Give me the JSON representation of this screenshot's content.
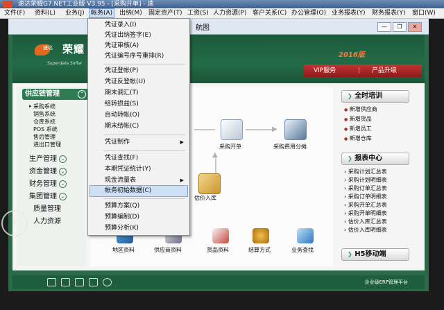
{
  "app": {
    "title": "速达荣耀G7.NET工业版 V3.95 - [采购开单] - 速"
  },
  "menubar": {
    "items": [
      "文件(F)",
      "资料(L)",
      "业务(J)",
      "帐务(A)",
      "出纳(M)",
      "固定资产(T)",
      "工资(S)",
      "人力资源(P)",
      "客户关系(C)",
      "办公管理(O)",
      "业务报表(Y)",
      "财务报表(Y)",
      "窗口(W)"
    ]
  },
  "inner_window": {
    "title": "航图"
  },
  "header": {
    "brand_name": "荣耀",
    "brand_prefix": "速达",
    "brand_sub": "Superdata Softw",
    "edition": "2016版",
    "vip": "VIP服务",
    "upgrade": "产品升级"
  },
  "left_panel": {
    "head": "供应链管理",
    "sub_items": [
      "采购系统",
      "销售系统",
      "仓库系统",
      "POS 系统",
      "售后管理",
      "进出口管理"
    ],
    "modules": [
      "生产管理",
      "资金管理",
      "财务管理",
      "集团管理",
      "质量管理",
      "人力资源"
    ]
  },
  "center": {
    "flow": {
      "purchase_order": "采购开单",
      "purchase_alloc": "采购费用分摊",
      "est_in": "估价入库"
    },
    "quick": [
      "地区资料",
      "供应商资料",
      "货品资料",
      "结算方式",
      "业务查找"
    ]
  },
  "right_panel": {
    "training": "全时培训",
    "training_links": [
      "新增供应商",
      "新增货品",
      "新增员工",
      "新增仓库"
    ],
    "report_head": "报表中心",
    "report_links": [
      "采购计划汇总表",
      "采购计划明细表",
      "采购订单汇总表",
      "采购订单明细表",
      "采购开单汇总表",
      "采购开单明细表",
      "估价入库汇总表",
      "估价入库明细表"
    ],
    "h5": "H5移动端"
  },
  "footer": {
    "text": "企业级ERP管理平台"
  },
  "dropdown": {
    "items": [
      "凭证录入(I)",
      "凭证出纳签字(E)",
      "凭证审核(A)",
      "凭证编号序号重排(R)",
      "凭证登帐(P)",
      "凭证反登帐(U)",
      "期末调汇(T)",
      "结转损益(S)",
      "自动转帐(O)",
      "期末结帐(C)",
      "凭证制作",
      "凭证查找(F)",
      "本期凭证统计(Y)",
      "现金流量表",
      "帐务初始数据(C)",
      "预算方案(Q)",
      "预算编制(D)",
      "预算分析(K)"
    ],
    "highlighted": "帐务初始数据(C)"
  }
}
